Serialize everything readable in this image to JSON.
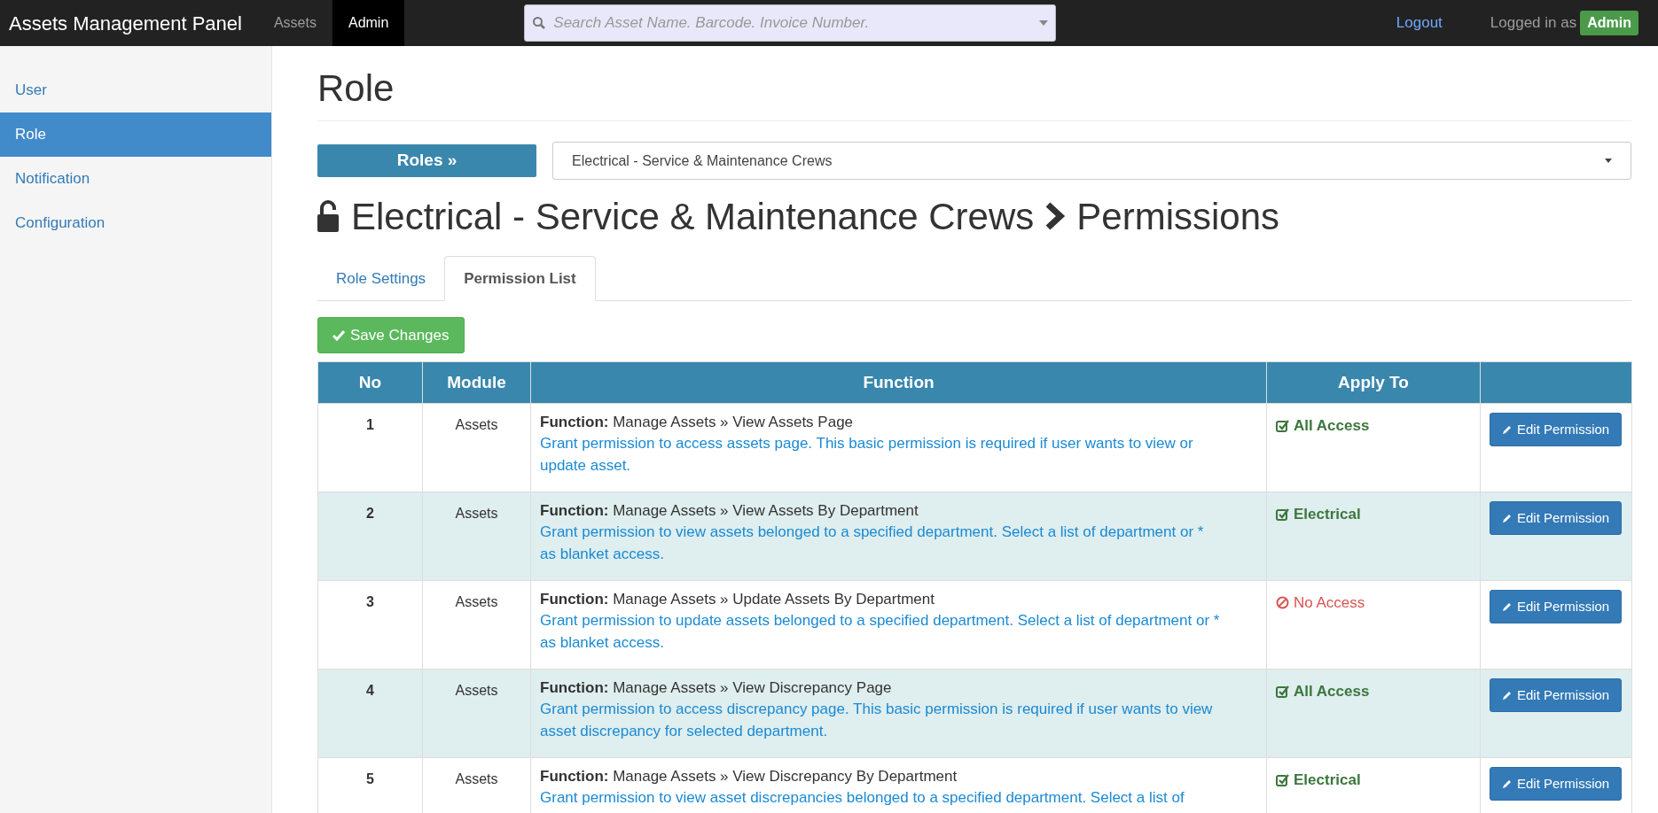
{
  "navbar": {
    "brand": "Assets Management Panel",
    "tabs": [
      {
        "label": "Assets",
        "selected": false
      },
      {
        "label": "Admin",
        "selected": true
      }
    ],
    "search": {
      "placeholder": "Search Asset Name. Barcode. Invoice Number."
    },
    "logout": "Logout",
    "logged_in_label": "Logged in as",
    "user_badge": "Admin"
  },
  "sidebar": {
    "items": [
      {
        "label": "User",
        "selected": false
      },
      {
        "label": "Role",
        "selected": true
      },
      {
        "label": "Notification",
        "selected": false
      },
      {
        "label": "Configuration",
        "selected": false
      }
    ]
  },
  "page_title": "Role",
  "roles_button": "Roles »",
  "role_select": {
    "value": "Electrical - Service & Maintenance Crews"
  },
  "heading": {
    "role": "Electrical - Service & Maintenance Crews",
    "section": "Permissions"
  },
  "tabs": [
    {
      "label": "Role Settings",
      "selected": false
    },
    {
      "label": "Permission List",
      "selected": true
    }
  ],
  "save_button": "Save Changes",
  "table": {
    "columns": [
      "No",
      "Module",
      "Function",
      "Apply To"
    ],
    "rows": [
      {
        "no": "1",
        "module": "Assets",
        "function_label": "Function:",
        "function": "Manage Assets » View Assets Page",
        "description": "Grant permission to access assets page. This basic permission is required if user wants to view or update asset.",
        "apply_to": "All Access",
        "granted": true,
        "action": "Edit Permission"
      },
      {
        "no": "2",
        "module": "Assets",
        "function_label": "Function:",
        "function": "Manage Assets » View Assets By Department",
        "description": "Grant permission to view assets belonged to a specified department. Select a list of department or * as blanket access.",
        "apply_to": "Electrical",
        "granted": true,
        "action": "Edit Permission"
      },
      {
        "no": "3",
        "module": "Assets",
        "function_label": "Function:",
        "function": "Manage Assets » Update Assets By Department",
        "description": "Grant permission to update assets belonged to a specified department. Select a list of department or * as blanket access.",
        "apply_to": "No Access",
        "granted": false,
        "action": "Edit Permission"
      },
      {
        "no": "4",
        "module": "Assets",
        "function_label": "Function:",
        "function": "Manage Assets » View Discrepancy Page",
        "description": "Grant permission to access discrepancy page. This basic permission is required if user wants to view asset discrepancy for selected department.",
        "apply_to": "All Access",
        "granted": true,
        "action": "Edit Permission"
      },
      {
        "no": "5",
        "module": "Assets",
        "function_label": "Function:",
        "function": "Manage Assets » View Discrepancy By Department",
        "description": "Grant permission to view asset discrepancies belonged to a specified department. Select a list of",
        "apply_to": "Electrical",
        "granted": true,
        "action": "Edit Permission"
      }
    ]
  }
}
